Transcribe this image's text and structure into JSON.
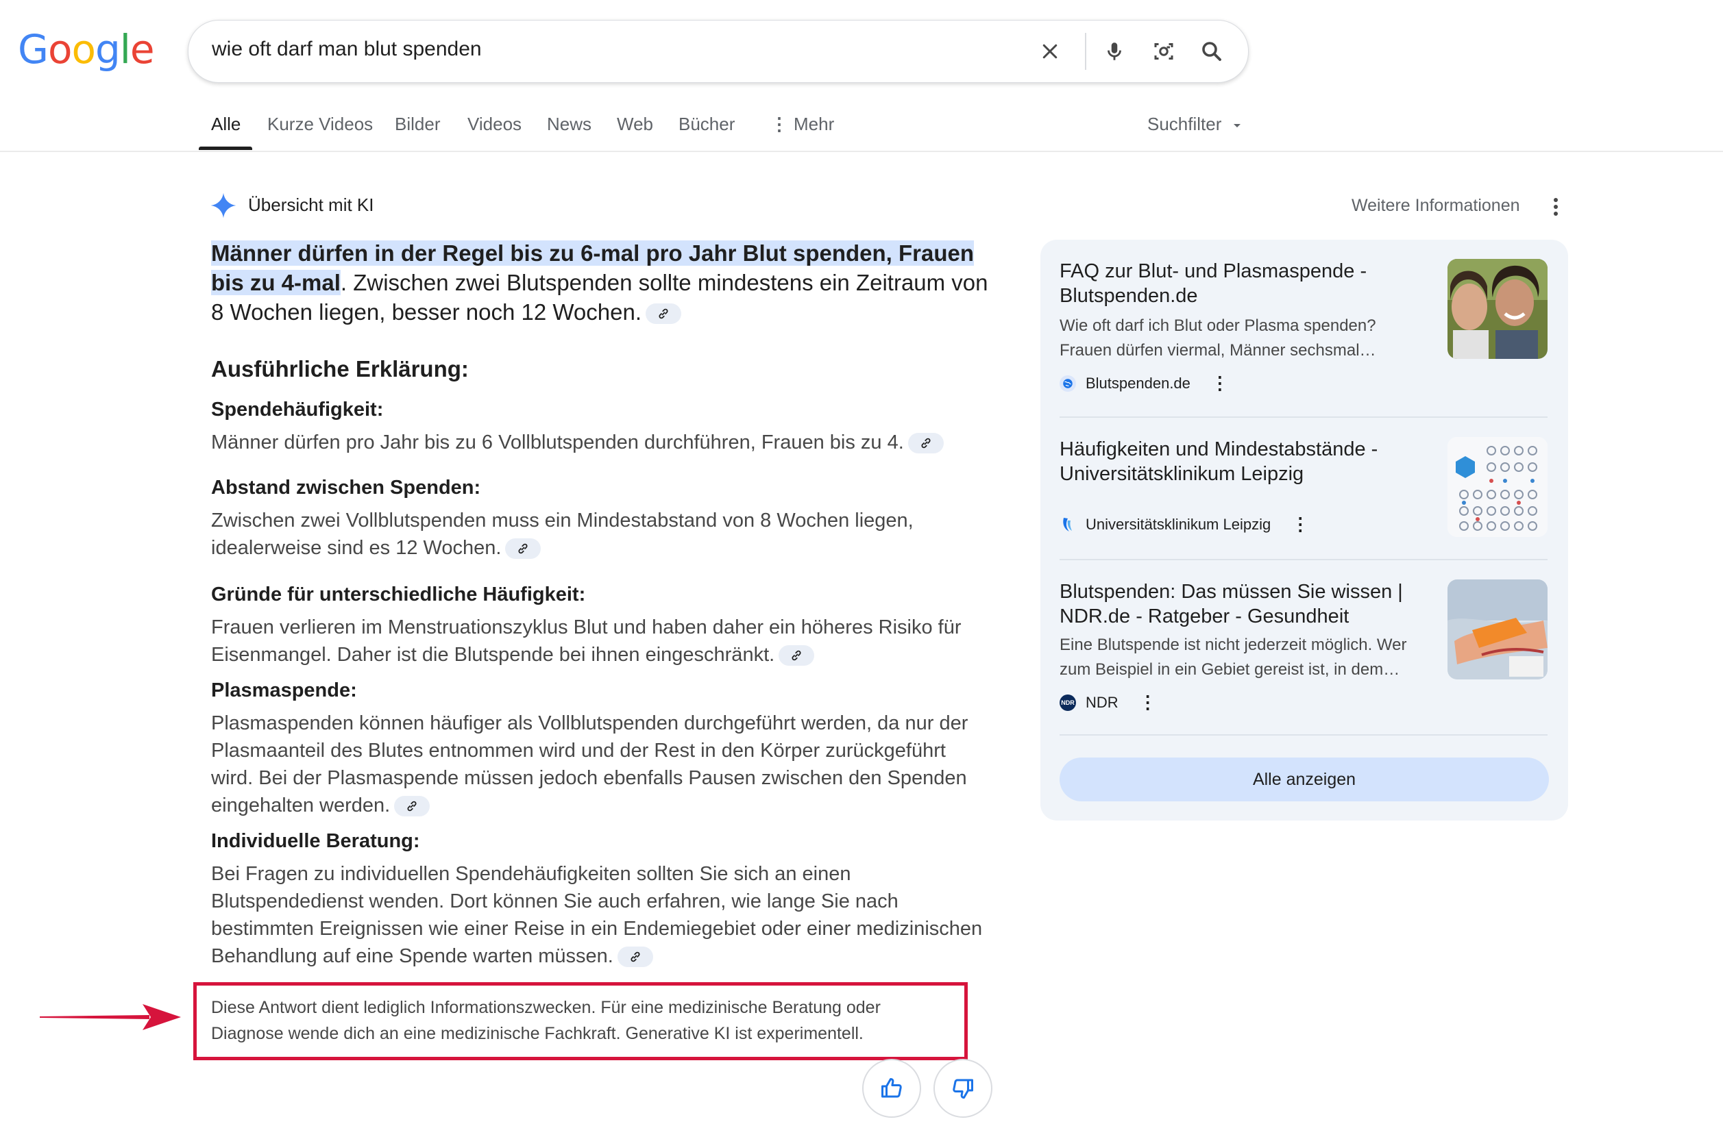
{
  "logo": {
    "letters": [
      "G",
      "o",
      "o",
      "g",
      "l",
      "e"
    ],
    "colors": [
      "#4285F4",
      "#EA4335",
      "#FBBC05",
      "#4285F4",
      "#34A853",
      "#EA4335"
    ]
  },
  "search": {
    "query": "wie oft darf man blut spenden"
  },
  "tabs": [
    "Alle",
    "Kurze Videos",
    "Bilder",
    "Videos",
    "News",
    "Web",
    "Bücher",
    "Mehr"
  ],
  "suchfilter": "Suchfilter",
  "ai": {
    "title": "Übersicht mit KI",
    "more_info": "Weitere Informationen",
    "lead_highlight": "Männer dürfen in der Regel bis zu 6-mal pro Jahr Blut spenden, Frauen bis zu 4-mal",
    "lead_rest": ". Zwischen zwei Blutspenden sollte mindestens ein Zeitraum von 8 Wochen liegen, besser noch 12 Wochen.",
    "heading": "Ausführliche Erklärung:",
    "sections": [
      {
        "title": "Spendehäufigkeit:",
        "text": "Männer dürfen pro Jahr bis zu 6 Vollblutspenden durchführen, Frauen bis zu 4."
      },
      {
        "title": "Abstand zwischen Spenden:",
        "text": "Zwischen zwei Vollblutspenden muss ein Mindestabstand von 8 Wochen liegen, idealerweise sind es 12 Wochen."
      },
      {
        "title": "Gründe für unterschiedliche Häufigkeit:",
        "text": "Frauen verlieren im Menstruationszyklus Blut und haben daher ein höheres Risiko für Eisenmangel. Daher ist die Blutspende bei ihnen eingeschränkt."
      },
      {
        "title": "Plasmaspende:",
        "text": "Plasmaspenden können häufiger als Vollblutspenden durchgeführt werden, da nur der Plasmaanteil des Blutes entnommen wird und der Rest in den Körper zurückgeführt wird. Bei der Plasmaspende müssen jedoch ebenfalls Pausen zwischen den Spenden eingehalten werden."
      },
      {
        "title": "Individuelle Beratung:",
        "text": "Bei Fragen zu individuellen Spendehäufigkeiten sollten Sie sich an einen Blutspendedienst wenden. Dort können Sie auch erfahren, wie lange Sie nach bestimmten Ereignissen wie einer Reise in ein Endemiegebiet oder einer medizinischen Behandlung auf eine Spende warten müssen."
      }
    ],
    "disclaimer": "Diese Antwort dient lediglich Informationszwecken. Für eine medizinische Beratung oder Diagnose wende dich an eine medizinische Fachkraft. Generative KI ist experimentell."
  },
  "sources": [
    {
      "title": "FAQ zur Blut- und Plasmaspende - Blutspenden.de",
      "snippet": "Wie oft darf ich Blut oder Plasma spenden? Frauen dürfen viermal, Männer sechsmal…",
      "site": "Blutspenden.de"
    },
    {
      "title": "Häufigkeiten und Mindestabstände - Universitätsklinikum Leipzig",
      "snippet": "",
      "site": "Universitätsklinikum Leipzig"
    },
    {
      "title": "Blutspenden: Das müssen Sie wissen | NDR.de - Ratgeber - Gesundheit",
      "snippet": "Eine Blutspende ist nicht jederzeit möglich. Wer zum Beispiel in ein Gebiet gereist ist, in dem…",
      "site": "NDR"
    }
  ],
  "show_all": "Alle anzeigen",
  "colors": {
    "accent": "#1a73e8",
    "highlight": "#d3e3fd",
    "panel": "#f0f4f9",
    "annotation": "#d6143c"
  }
}
